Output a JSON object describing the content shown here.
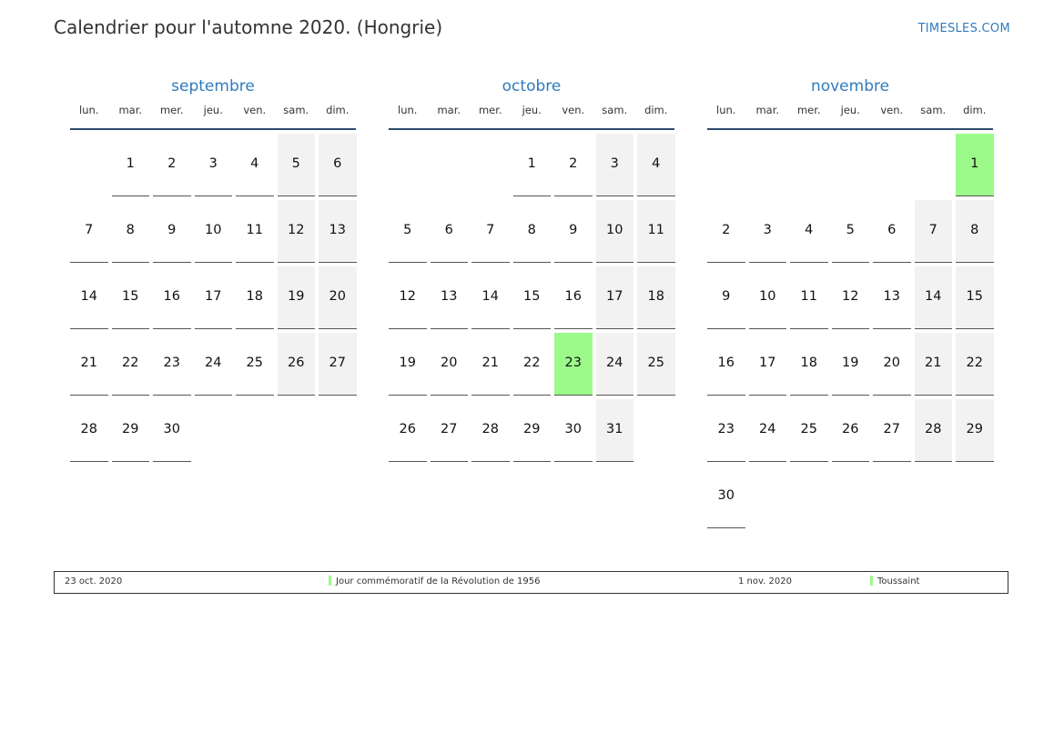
{
  "title": "Calendrier pour l'automne 2020. (Hongrie)",
  "site": "TIMESLES.COM",
  "colors": {
    "accent": "#2f7bbf",
    "weekend": "#f2f2f2",
    "holiday": "#9cfa8a",
    "rule": "#2e4a6d"
  },
  "weekdays": [
    "lun.",
    "mar.",
    "mer.",
    "jeu.",
    "ven.",
    "sam.",
    "dim."
  ],
  "months": [
    {
      "name": "septembre",
      "offset": 1,
      "days": 30,
      "holidays": []
    },
    {
      "name": "octobre",
      "offset": 3,
      "days": 31,
      "holidays": [
        23
      ]
    },
    {
      "name": "novembre",
      "offset": 6,
      "days": 30,
      "holidays": [
        1
      ]
    }
  ],
  "legend": [
    {
      "date": "23 oct. 2020",
      "name": "Jour commémoratif de la Révolution de 1956",
      "color": "#9cfa8a"
    },
    {
      "date": "1 nov. 2020",
      "name": "Toussaint",
      "color": "#9cfa8a"
    }
  ]
}
